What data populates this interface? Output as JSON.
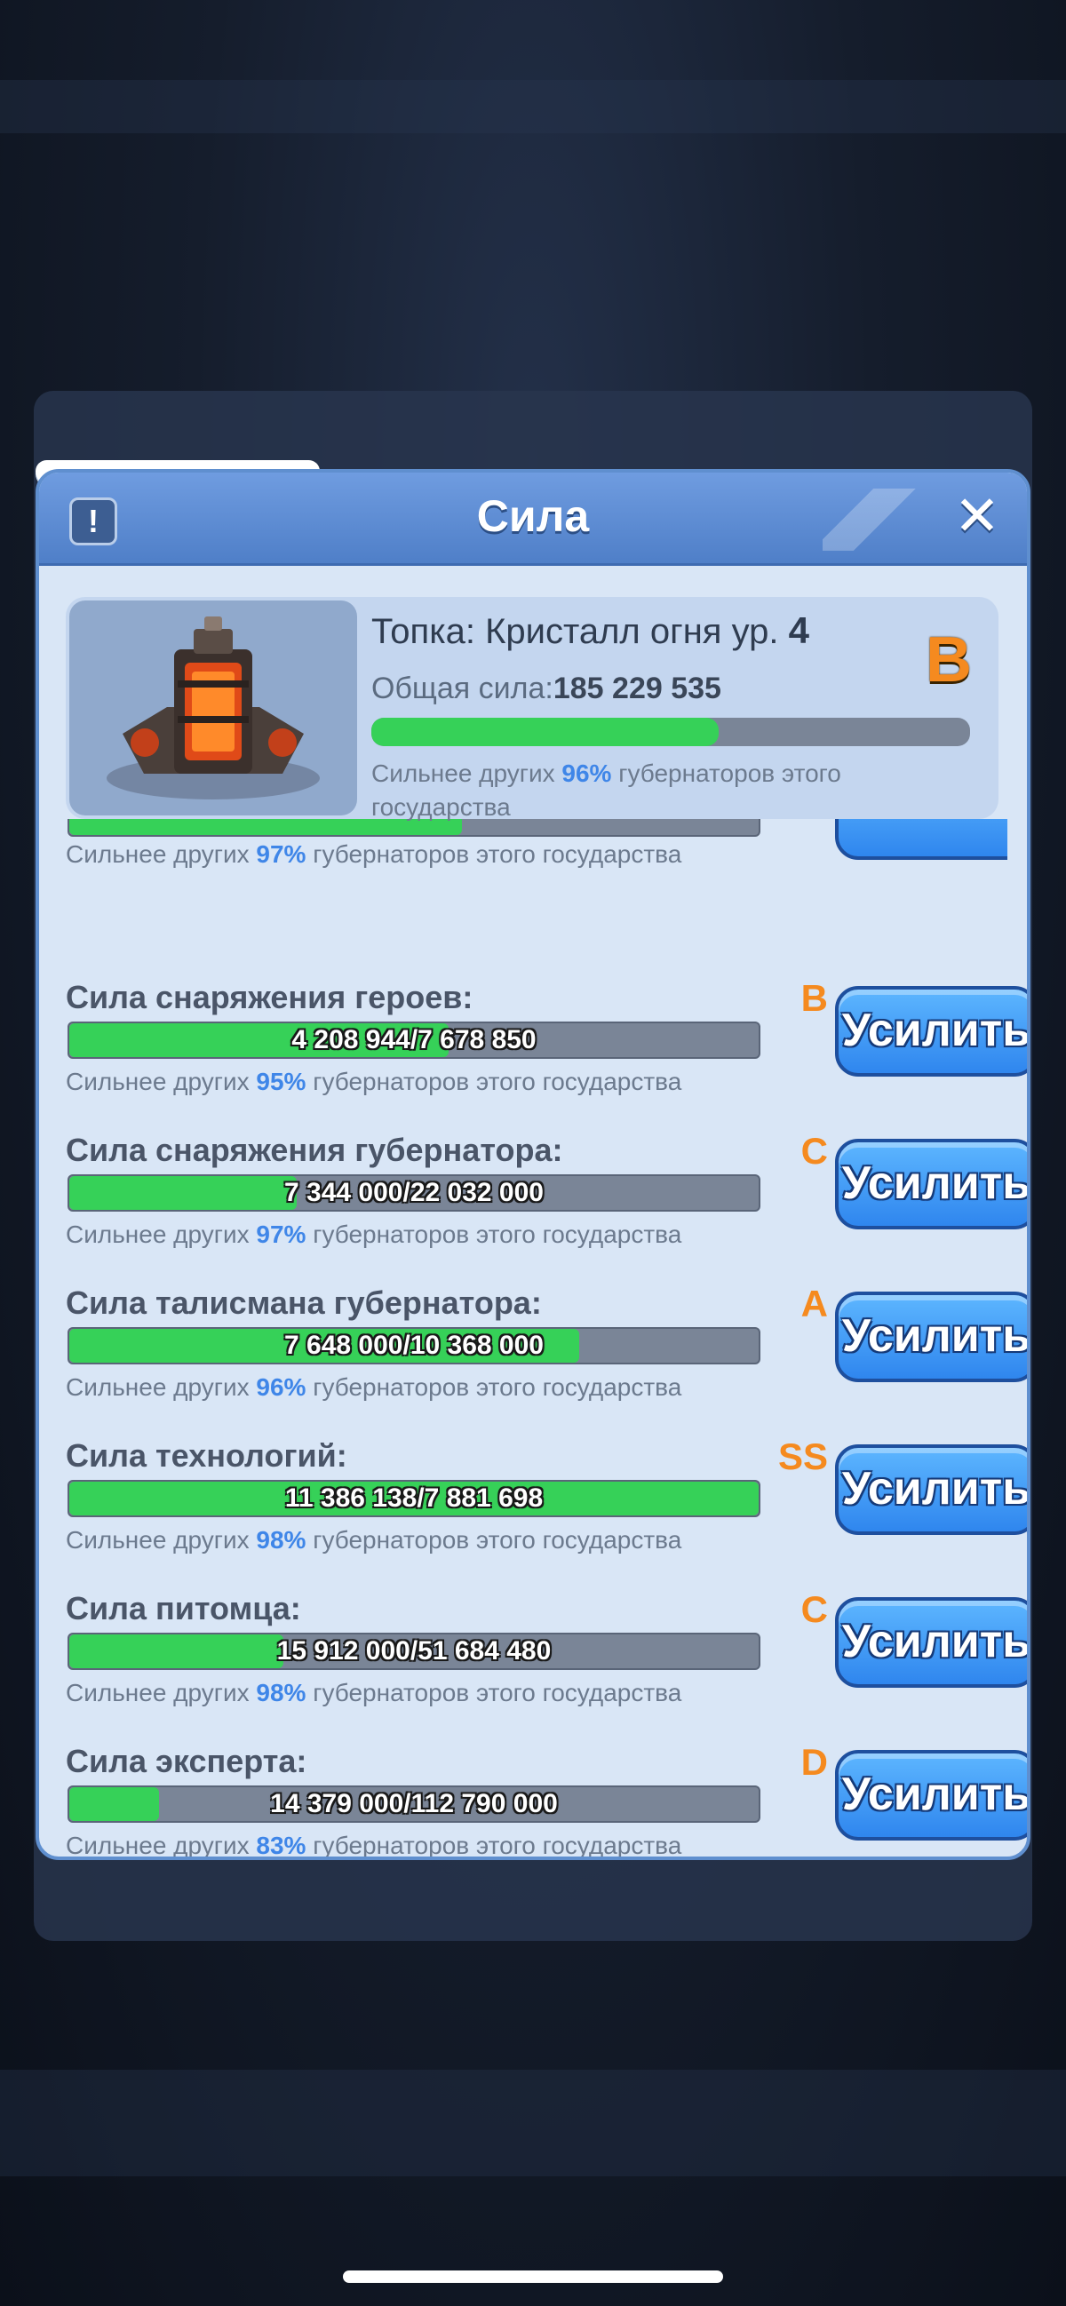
{
  "header": {
    "title": "Сила",
    "info_label": "!",
    "close_label": "✕"
  },
  "summary": {
    "title_prefix": "Топка: Кристалл огня ур.",
    "level": "4",
    "grade": "B",
    "power_label": "Общая сила:",
    "power_value": "185 229 535",
    "progress_fraction": 0.58,
    "note_prefix": "Сильнее других",
    "note_pct": "96%",
    "note_suffix": "губернаторов этого государства"
  },
  "partial_row": {
    "note_prefix": "Сильнее других",
    "note_pct": "97%",
    "note_suffix": "губернаторов этого государства",
    "progress_fraction": 0.57
  },
  "rows": [
    {
      "label": "Сила снаряжения героев:",
      "grade": "B",
      "value": "4 208 944/7 678 850",
      "fraction": 0.55,
      "note_prefix": "Сильнее других",
      "pct": "95%",
      "note_suffix": "губернаторов этого государства",
      "button": "Усилить"
    },
    {
      "label": "Сила снаряжения губернатора:",
      "grade": "C",
      "value": "7 344 000/22 032 000",
      "fraction": 0.33,
      "note_prefix": "Сильнее других",
      "pct": "97%",
      "note_suffix": "губернаторов этого государства",
      "button": "Усилить"
    },
    {
      "label": "Сила талисмана губернатора:",
      "grade": "A",
      "value": "7 648 000/10 368 000",
      "fraction": 0.74,
      "note_prefix": "Сильнее других",
      "pct": "96%",
      "note_suffix": "губернаторов этого государства",
      "button": "Усилить"
    },
    {
      "label": "Сила технологий:",
      "grade": "SS",
      "value": "11 386 138/7 881 698",
      "fraction": 1.0,
      "note_prefix": "Сильнее других",
      "pct": "98%",
      "note_suffix": "губернаторов этого государства",
      "button": "Усилить"
    },
    {
      "label": "Сила питомца:",
      "grade": "C",
      "value": "15 912 000/51 684 480",
      "fraction": 0.31,
      "note_prefix": "Сильнее других",
      "pct": "98%",
      "note_suffix": "губернаторов этого государства",
      "button": "Усилить"
    },
    {
      "label": "Сила эксперта:",
      "grade": "D",
      "value": "14 379 000/112 790 000",
      "fraction": 0.13,
      "note_prefix": "Сильнее других",
      "pct": "83%",
      "note_suffix": "губернаторов этого государства",
      "button": "Усилить"
    }
  ]
}
